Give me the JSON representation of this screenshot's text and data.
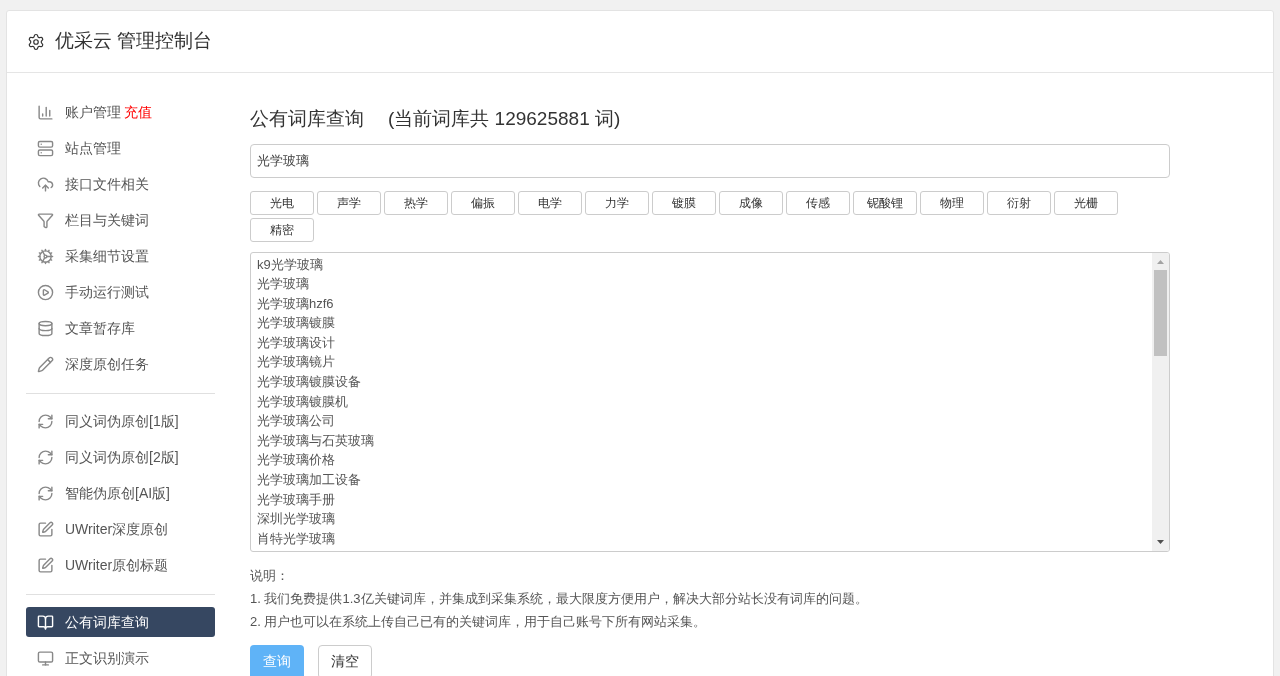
{
  "header": {
    "title": "优采云 管理控制台"
  },
  "sidebar": {
    "groups": [
      {
        "items": [
          {
            "label": "账户管理",
            "badge": "充值",
            "selected": false
          },
          {
            "label": "站点管理",
            "selected": false
          },
          {
            "label": "接口文件相关",
            "selected": false
          },
          {
            "label": "栏目与关键词",
            "selected": false
          },
          {
            "label": "采集细节设置",
            "selected": false
          },
          {
            "label": "手动运行测试",
            "selected": false
          },
          {
            "label": "文章暂存库",
            "selected": false
          },
          {
            "label": "深度原创任务",
            "selected": false
          }
        ]
      },
      {
        "items": [
          {
            "label": "同义词伪原创[1版]",
            "selected": false
          },
          {
            "label": "同义词伪原创[2版]",
            "selected": false
          },
          {
            "label": "智能伪原创[AI版]",
            "selected": false
          },
          {
            "label": "UWriter深度原创",
            "selected": false
          },
          {
            "label": "UWriter原创标题",
            "selected": false
          }
        ]
      },
      {
        "items": [
          {
            "label": "公有词库查询",
            "selected": true
          },
          {
            "label": "正文识别演示",
            "selected": false
          }
        ]
      }
    ]
  },
  "main": {
    "title": "公有词库查询",
    "count_note": "(当前词库共 129625881 词)",
    "search": {
      "value": "光学玻璃"
    },
    "tags": [
      "光电",
      "声学",
      "热学",
      "偏振",
      "电学",
      "力学",
      "镀膜",
      "成像",
      "传感",
      "铌酸锂",
      "物理",
      "衍射",
      "光栅",
      "精密"
    ],
    "results": [
      "k9光学玻璃",
      "光学玻璃",
      "光学玻璃hzf6",
      "光学玻璃镀膜",
      "光学玻璃设计",
      "光学玻璃镜片",
      "光学玻璃镀膜设备",
      "光学玻璃镀膜机",
      "光学玻璃公司",
      "光学玻璃与石英玻璃",
      "光学玻璃价格",
      "光学玻璃加工设备",
      "光学玻璃手册",
      "深圳光学玻璃",
      "肖特光学玻璃"
    ],
    "notes_title": "说明：",
    "notes": [
      "1. 我们免费提供1.3亿关键词库，并集成到采集系统，最大限度方便用户，解决大部分站长没有词库的问题。",
      "2. 用户也可以在系统上传自己已有的关键词库，用于自己账号下所有网站采集。"
    ],
    "buttons": [
      {
        "label": "查询",
        "kind": "primary"
      },
      {
        "label": "清空",
        "kind": "default"
      }
    ]
  }
}
